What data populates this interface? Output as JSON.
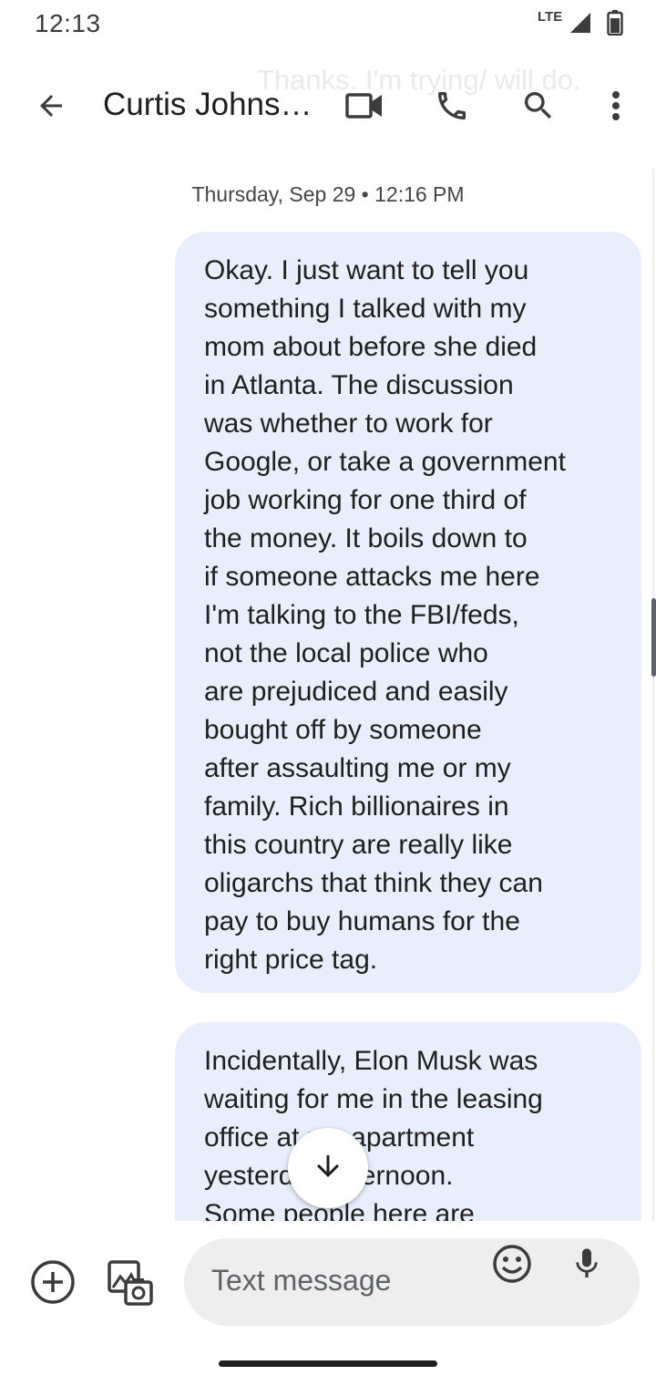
{
  "status_bar": {
    "time": "12:13",
    "network": "LTE",
    "icons": [
      "signal-icon",
      "battery-icon"
    ]
  },
  "background": {
    "ghost_text": "Thanks. I'm trying/ will do."
  },
  "header": {
    "contact_name": "Curtis Johns…",
    "icons": [
      "back-arrow-icon",
      "video-call-icon",
      "phone-icon",
      "search-icon",
      "more-vert-icon"
    ]
  },
  "conversation": {
    "date_header": "Thursday, Sep 29 • 12:16 PM",
    "messages": [
      {
        "text": "Okay. I just want to tell you\nsomething I talked with my\nmom about before she died\nin Atlanta. The discussion\nwas whether to work for\nGoogle, or take a government\njob working for one third of\nthe money. It boils down to\nif someone attacks me here\nI'm talking to the FBI/feds,\nnot the local police who\nare prejudiced and easily\nbought off by someone\nafter assaulting me or my\nfamily. Rich billionaires in\nthis country are really like\noligarchs that think they can\npay to buy humans for the\nright price tag."
      },
      {
        "text": "Incidentally, Elon Musk was\nwaiting for me in the leasing\noffice at my apartment\nyesterday afternoon.\nSome people here are"
      }
    ]
  },
  "jump_button": {
    "icon": "arrow-down-icon"
  },
  "compose": {
    "placeholder": "Text message",
    "icons": [
      "add-icon",
      "gallery-icon",
      "emoji-icon",
      "mic-icon"
    ]
  },
  "colors": {
    "bubble": "#e8eefb",
    "text": "#1f1f1f",
    "secondary_text": "#444746",
    "input_bg": "#eeeeee"
  }
}
